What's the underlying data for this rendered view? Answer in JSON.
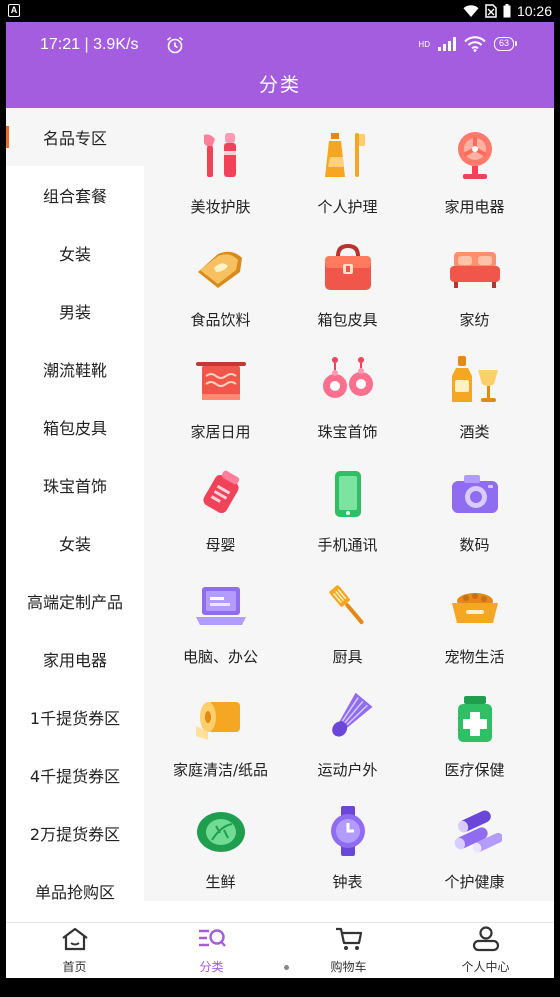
{
  "system_bar": {
    "badge": "A",
    "time": "10:26"
  },
  "app_status": {
    "time_speed": "17:21 | 3.9K/s",
    "network": "HD",
    "battery": "63"
  },
  "header": {
    "title": "分类"
  },
  "sidebar": {
    "items": [
      {
        "label": "名品专区",
        "active": true
      },
      {
        "label": "组合套餐"
      },
      {
        "label": "女装"
      },
      {
        "label": "男装"
      },
      {
        "label": "潮流鞋靴"
      },
      {
        "label": "箱包皮具"
      },
      {
        "label": "珠宝首饰"
      },
      {
        "label": "女装"
      },
      {
        "label": "高端定制产品"
      },
      {
        "label": "家用电器"
      },
      {
        "label": "1千提货券区"
      },
      {
        "label": "4千提货券区"
      },
      {
        "label": "2万提货券区"
      },
      {
        "label": "单品抢购区"
      }
    ]
  },
  "grid": {
    "items": [
      {
        "label": "美妆护肤",
        "icon": "makeup-brush-icon"
      },
      {
        "label": "个人护理",
        "icon": "toothpaste-icon"
      },
      {
        "label": "家用电器",
        "icon": "fan-icon"
      },
      {
        "label": "食品饮料",
        "icon": "toast-bread-icon"
      },
      {
        "label": "箱包皮具",
        "icon": "handbag-icon"
      },
      {
        "label": "家纺",
        "icon": "sofa-bed-icon"
      },
      {
        "label": "家居日用",
        "icon": "towel-rack-icon"
      },
      {
        "label": "珠宝首饰",
        "icon": "earrings-icon"
      },
      {
        "label": "酒类",
        "icon": "wine-bottle-icon"
      },
      {
        "label": "母婴",
        "icon": "baby-bottle-bag-icon"
      },
      {
        "label": "手机通讯",
        "icon": "mobile-phone-icon"
      },
      {
        "label": "数码",
        "icon": "camera-icon"
      },
      {
        "label": "电脑、办公",
        "icon": "laptop-icon"
      },
      {
        "label": "厨具",
        "icon": "spatula-icon"
      },
      {
        "label": "宠物生活",
        "icon": "pet-bowl-icon"
      },
      {
        "label": "家庭清洁/纸品",
        "icon": "tissue-roll-icon"
      },
      {
        "label": "运动户外",
        "icon": "shuttlecock-icon"
      },
      {
        "label": "医疗保健",
        "icon": "medicine-bottle-icon"
      },
      {
        "label": "生鲜",
        "icon": "cabbage-icon"
      },
      {
        "label": "钟表",
        "icon": "watch-icon"
      },
      {
        "label": "个护健康",
        "icon": "logs-icon"
      }
    ]
  },
  "bottom_nav": {
    "items": [
      {
        "label": "首页",
        "icon": "home-icon"
      },
      {
        "label": "分类",
        "icon": "category-search-icon",
        "active": true
      },
      {
        "label": "购物车",
        "icon": "cart-icon"
      },
      {
        "label": "个人中心",
        "icon": "user-icon"
      }
    ]
  },
  "colors": {
    "header_purple": "#a55de0",
    "active_indicator": "#f26a2b",
    "icon_red": "#f0435a",
    "icon_orange": "#f5a623",
    "icon_purple": "#8f6cf0",
    "icon_green": "#2fbf64"
  }
}
